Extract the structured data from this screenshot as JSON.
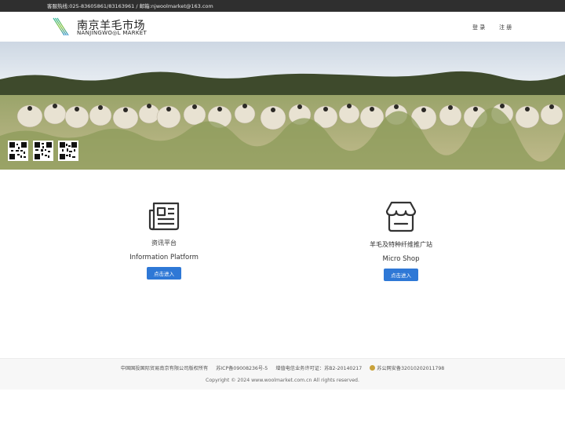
{
  "topbar": {
    "contact": "客服热线:025-83605861/83163961 / 邮箱:njwoolmarket@163.com"
  },
  "header": {
    "logo_cn": "南京羊毛市场",
    "logo_en": "NANJINGWO◎L MARKET",
    "login": "登 录",
    "register": "注 册"
  },
  "cards": [
    {
      "icon": "newspaper-icon",
      "title_cn": "资讯平台",
      "title_en": "Information Platform",
      "button": "点击进入"
    },
    {
      "icon": "storefront-icon",
      "title_cn": "羊毛及特种纤维推广站",
      "title_en": "Micro Shop",
      "button": "点击进入"
    }
  ],
  "footer": {
    "company": "中国国投国际贸易南京有限公司版权所有",
    "icp": "苏ICP备09008236号-5",
    "telecom": "增值电信业务许可证：苏B2-20140217",
    "police": "苏公网安备32010202011798",
    "copyright": "Copyright © 2024 www.woolmarket.com.cn All rights reserved."
  },
  "colors": {
    "topbar": "#2f2f2f",
    "button": "#2e78d6",
    "footer_bg": "#f7f7f7"
  }
}
